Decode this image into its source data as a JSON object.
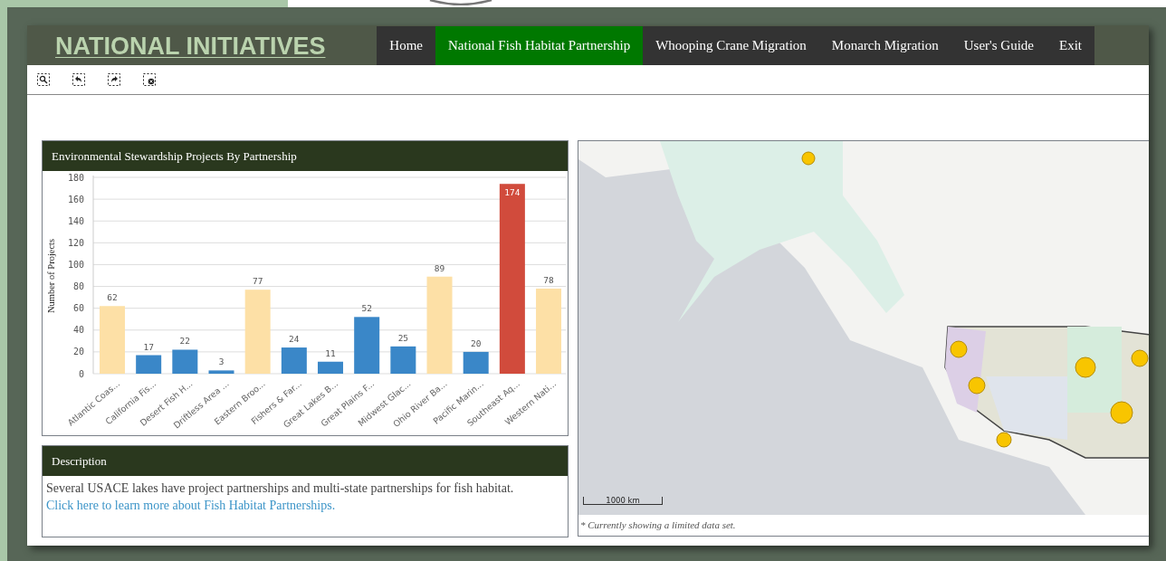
{
  "header": {
    "title": "NATIONAL INITIATIVES"
  },
  "nav": [
    {
      "label": "Home",
      "selected": false
    },
    {
      "label": "National Fish Habitat Partnership",
      "selected": true
    },
    {
      "label": "Whooping Crane Migration",
      "selected": false
    },
    {
      "label": "Monarch Migration",
      "selected": false
    },
    {
      "label": "User's Guide",
      "selected": false
    },
    {
      "label": "Exit",
      "selected": false
    }
  ],
  "toolbar": [
    {
      "kind": "zoom"
    },
    {
      "kind": "back"
    },
    {
      "kind": "forward"
    },
    {
      "kind": "clear"
    }
  ],
  "chart_panel": {
    "chart_data": {
      "type": "bar",
      "title": "Environmental Stewardship Projects By Partnership",
      "ylabel": "Number of Projects",
      "categories": [
        "Atlantic Coas...",
        "California Fis...",
        "Desert Fish H...",
        "Driftless Area ...",
        "Eastern Broo...",
        "Fishers & Far...",
        "Great Lakes B...",
        "Great Plains F...",
        "Midwest Glac...",
        "Ohio River Ba...",
        "Pacific Marin...",
        "Southeast Aq...",
        "Western Nati..."
      ],
      "series": [
        {
          "color": "#fde0a6",
          "values": [
            62,
            null,
            null,
            null,
            77,
            null,
            null,
            null,
            null,
            89,
            null,
            null,
            78
          ]
        },
        {
          "color": "#3a87c8",
          "values": [
            null,
            17,
            22,
            3,
            null,
            24,
            11,
            52,
            25,
            null,
            20,
            null,
            null
          ]
        },
        {
          "color": "#d14b3c",
          "values": [
            null,
            null,
            null,
            null,
            null,
            null,
            null,
            null,
            null,
            null,
            null,
            174,
            null
          ]
        }
      ],
      "stacked": true,
      "grid": true,
      "ylim": [
        0,
        180
      ],
      "yticks": [
        0,
        20,
        40,
        60,
        80,
        100,
        120,
        140,
        160,
        180
      ],
      "data_labels": true
    }
  },
  "description": {
    "title": "Description",
    "text": "Several USACE lakes have project partnerships and multi-state partnerships for fish habitat.",
    "link": "Click here to learn more about Fish Habitat Partnerships."
  },
  "map": {
    "kind": "picture",
    "scale_label": "1000 km",
    "footnote": "* Currently showing a limited data set."
  }
}
